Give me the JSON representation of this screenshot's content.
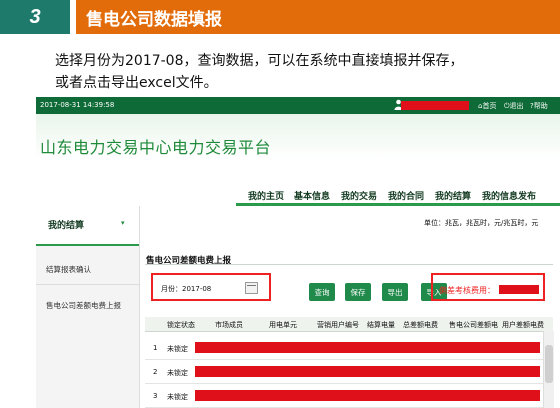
{
  "slide": {
    "step_number": "3",
    "step_title": "售电公司数据填报",
    "instruction_line1": "选择月份为2017-08，查询数据，可以在系统中直接填报并保存，",
    "instruction_line2": "或者点击导出excel文件。"
  },
  "topbar": {
    "datetime": "2017-08-31 14:39:58",
    "user_icon": "user-icon",
    "home": "⌂首页",
    "logout": "⏻退出",
    "help": "?帮助"
  },
  "header": {
    "platform_title": "山东电力交易中心电力交易平台"
  },
  "nav": {
    "items": [
      "我的主页",
      "基本信息",
      "我的交易",
      "我的合同",
      "我的结算",
      "我的信息发布"
    ]
  },
  "sidebar": {
    "section": "我的结算",
    "caret": "▾",
    "items": [
      "结算报表确认",
      "售电公司差额电费上报"
    ]
  },
  "unit_text": "单位：兆瓦，兆瓦时，元/兆瓦时，元",
  "main": {
    "section_title": "售电公司差额电费上报",
    "month_label": "月份：2017-08",
    "buttons": {
      "query": "查询",
      "save": "保存",
      "export": "导出",
      "import": "导入"
    },
    "fee_label": "偏差考核费用："
  },
  "table": {
    "headers": [
      "锁定状态",
      "市场成员",
      "用电单元",
      "营销用户编号",
      "结算电量",
      "总差额电费",
      "售电公司差额电",
      "用户差额电费"
    ],
    "rows": [
      {
        "num": "1",
        "status": "未锁定"
      },
      {
        "num": "2",
        "status": "未锁定"
      },
      {
        "num": "3",
        "status": "未锁定"
      }
    ]
  },
  "colors": {
    "header_teal": "#1e7a6a",
    "header_orange": "#e36c0a",
    "topbar_green": "#0e6a36",
    "redaction": "#e0101a",
    "button_green": "#1f8a4a"
  }
}
